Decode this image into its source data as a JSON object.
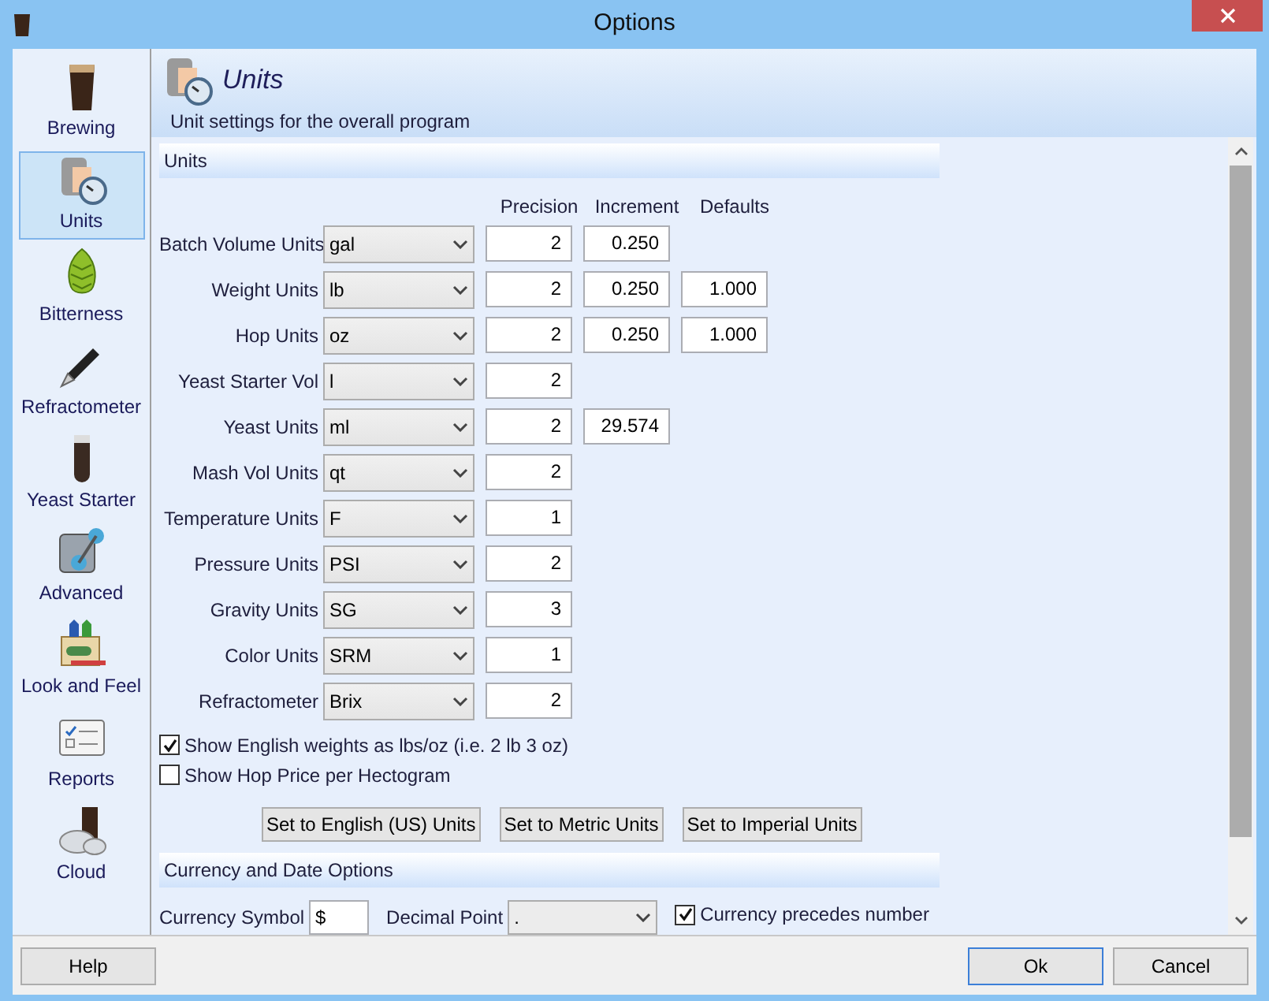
{
  "window": {
    "title": "Options"
  },
  "sidebar": {
    "items": [
      {
        "label": "Brewing",
        "selected": false
      },
      {
        "label": "Units",
        "selected": true
      },
      {
        "label": "Bitterness",
        "selected": false
      },
      {
        "label": "Refractometer",
        "selected": false
      },
      {
        "label": "Yeast Starter",
        "selected": false
      },
      {
        "label": "Advanced",
        "selected": false
      },
      {
        "label": "Look and Feel",
        "selected": false
      },
      {
        "label": "Reports",
        "selected": false
      },
      {
        "label": "Cloud",
        "selected": false
      }
    ]
  },
  "header": {
    "title": "Units",
    "subtitle": "Unit settings for the overall program"
  },
  "units_section": {
    "title": "Units",
    "columns": [
      "Precision",
      "Increment",
      "Defaults"
    ],
    "rows": [
      {
        "label": "Batch Volume Units",
        "unit": "gal",
        "precision": "2",
        "increment": "0.250"
      },
      {
        "label": "Weight Units",
        "unit": "lb",
        "precision": "2",
        "increment": "0.250",
        "default": "1.000"
      },
      {
        "label": "Hop Units",
        "unit": "oz",
        "precision": "2",
        "increment": "0.250",
        "default": "1.000"
      },
      {
        "label": "Yeast Starter Vol",
        "unit": "l",
        "precision": "2"
      },
      {
        "label": "Yeast Units",
        "unit": "ml",
        "precision": "2",
        "increment": "29.574"
      },
      {
        "label": "Mash Vol Units",
        "unit": "qt",
        "precision": "2"
      },
      {
        "label": "Temperature Units",
        "unit": "F",
        "precision": "1"
      },
      {
        "label": "Pressure Units",
        "unit": "PSI",
        "precision": "2"
      },
      {
        "label": "Gravity Units",
        "unit": "SG",
        "precision": "3"
      },
      {
        "label": "Color Units",
        "unit": "SRM",
        "precision": "1"
      },
      {
        "label": "Refractometer",
        "unit": "Brix",
        "precision": "2"
      }
    ],
    "checkboxes": [
      {
        "label": "Show English weights as lbs/oz (i.e. 2 lb 3 oz)",
        "checked": true
      },
      {
        "label": "Show Hop Price per Hectogram",
        "checked": false
      }
    ],
    "buttons": [
      "Set to English (US) Units",
      "Set to Metric Units",
      "Set to Imperial Units"
    ]
  },
  "currency_section": {
    "title": "Currency and Date Options",
    "currency_symbol_label": "Currency Symbol",
    "currency_symbol": "$",
    "decimal_point_label": "Decimal Point",
    "decimal_point": ".",
    "precedes": {
      "label": "Currency precedes number",
      "checked": true
    }
  },
  "footer": {
    "buttons": [
      {
        "label": "Help",
        "focused": false
      },
      {
        "label": "Ok",
        "focused": true
      },
      {
        "label": "Cancel",
        "focused": false
      }
    ]
  }
}
